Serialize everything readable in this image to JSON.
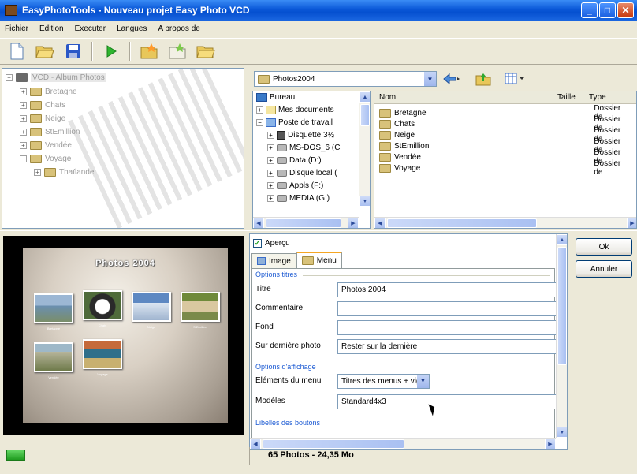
{
  "window": {
    "title": "EasyPhotoTools - Nouveau projet Easy Photo VCD",
    "minimize": "_",
    "maximize": "□",
    "close": "✕"
  },
  "menu": [
    "Fichier",
    "Edition",
    "Executer",
    "Langues",
    "A propos de"
  ],
  "toolbar_icons": [
    "new-document-icon",
    "open-folder-icon",
    "save-icon",
    "run-icon",
    "add-folder-icon",
    "remove-folder-icon",
    "open-folder-icon"
  ],
  "album_tree": {
    "root": "VCD - Album Photos",
    "items": [
      "Bretagne",
      "Chats",
      "Neige",
      "StEmillion",
      "Vendée",
      "Voyage"
    ],
    "sub_items": [
      "Thaïlande"
    ]
  },
  "browser": {
    "path": "Photos2004",
    "dirs": [
      {
        "label": "Bureau",
        "icon": "desktop-icon"
      },
      {
        "label": "Mes documents",
        "icon": "documents-icon"
      },
      {
        "label": "Poste de travail",
        "icon": "computer-icon"
      },
      {
        "label": "Disquette 3½",
        "icon": "floppy-icon"
      },
      {
        "label": "MS-DOS_6 (C",
        "icon": "drive-icon"
      },
      {
        "label": "Data (D:)",
        "icon": "drive-icon"
      },
      {
        "label": "Disque local (",
        "icon": "drive-icon"
      },
      {
        "label": "Appls (F:)",
        "icon": "drive-icon"
      },
      {
        "label": "MEDIA (G:)",
        "icon": "drive-icon"
      }
    ],
    "columns": {
      "name": "Nom",
      "size": "Taille",
      "type": "Type"
    },
    "files": [
      {
        "name": "Bretagne",
        "type": "Dossier de"
      },
      {
        "name": "Chats",
        "type": "Dossier de"
      },
      {
        "name": "Neige",
        "type": "Dossier de"
      },
      {
        "name": "StEmillion",
        "type": "Dossier de"
      },
      {
        "name": "Vendée",
        "type": "Dossier de"
      },
      {
        "name": "Voyage",
        "type": "Dossier de"
      }
    ]
  },
  "preview": {
    "title": "Photos 2004",
    "thumbnails": [
      {
        "caption": "Bretagne",
        "color": "#6a8fb0"
      },
      {
        "caption": "Chats",
        "color": "#4f6b3a"
      },
      {
        "caption": "Neige",
        "color": "#9fb4cf"
      },
      {
        "caption": "StEmillion",
        "color": "#7a8a4a"
      },
      {
        "caption": "Vendée",
        "color": "#8c8f7a"
      },
      {
        "caption": "Voyage",
        "color": "#3f6f8a"
      }
    ]
  },
  "options": {
    "preview_checkbox": "Aperçu",
    "preview_checked": true,
    "tabs": [
      "Image",
      "Menu"
    ],
    "active_tab": "Menu",
    "group_titles": "Options titres",
    "fields_titles": [
      {
        "label": "Titre",
        "value": "Photos 2004"
      },
      {
        "label": "Commentaire",
        "value": ""
      },
      {
        "label": "Fond",
        "value": ""
      },
      {
        "label": "Sur dernière photo",
        "value": "Rester sur la dernière"
      }
    ],
    "group_display": "Options d'affichage",
    "menu_elements_label": "Eléments du menu",
    "menu_elements_value": "Titres des menus + vignet",
    "models_label": "Modèles",
    "models_value": "Standard4x3",
    "group_buttons": "Libellés des boutons"
  },
  "buttons": {
    "ok": "Ok",
    "cancel": "Annuler"
  },
  "status": {
    "text": "65 Photos - 24,35 Mo"
  }
}
